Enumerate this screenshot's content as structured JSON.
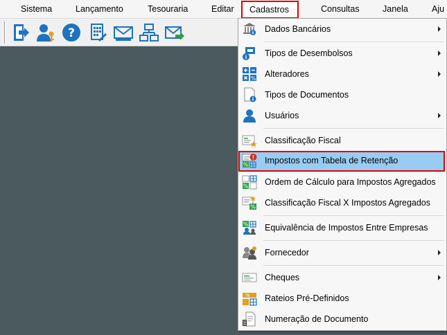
{
  "menubar": {
    "items": [
      "Sistema",
      "Lançamento",
      "Tesouraria",
      "Editar",
      "Cadastros",
      "Consultas",
      "Janela",
      "Aju"
    ],
    "active": "Cadastros"
  },
  "toolbar": {
    "buttons": [
      "exit-icon",
      "user-key-icon",
      "help-icon",
      "calculator-icon",
      "mail-icon",
      "network-icon",
      "mail-send-icon"
    ]
  },
  "dropdown": {
    "items": [
      {
        "label": "Dados Bancários",
        "icon": "bank-icon",
        "submenu": true
      },
      {
        "label": "Tipos de Desembolsos",
        "icon": "disbursement-icon",
        "submenu": true
      },
      {
        "label": "Alteradores",
        "icon": "math-operators-icon",
        "submenu": true
      },
      {
        "label": "Tipos de Documentos",
        "icon": "document-info-icon",
        "submenu": false
      },
      {
        "label": "Usuários",
        "icon": "user-icon",
        "submenu": true
      },
      {
        "label": "Classificação Fiscal",
        "icon": "fiscal-classification-icon",
        "submenu": false
      },
      {
        "label": "Impostos com Tabela de Retenção",
        "icon": "tax-retention-icon",
        "submenu": false,
        "highlighted": true
      },
      {
        "label": "Ordem de Cálculo para Impostos Agregados",
        "icon": "tax-order-icon",
        "submenu": false
      },
      {
        "label": "Classificação Fiscal X Impostos Agregados",
        "icon": "fiscal-tax-icon",
        "submenu": false
      },
      {
        "label": "Equivalência de Impostos Entre Empresas",
        "icon": "tax-equivalence-icon",
        "submenu": false
      },
      {
        "label": "Fornecedor",
        "icon": "supplier-icon",
        "submenu": true
      },
      {
        "label": "Cheques",
        "icon": "cheque-icon",
        "submenu": true
      },
      {
        "label": "Rateios Pré-Definidos",
        "icon": "apportionment-icon",
        "submenu": false
      },
      {
        "label": "Numeração de Documento",
        "icon": "document-numbering-icon",
        "submenu": false
      }
    ]
  },
  "colors": {
    "highlight": "#99ccf3",
    "highlight_border": "#e00000",
    "workspace": "#4a5a5e",
    "accent_blue": "#1e73be"
  }
}
